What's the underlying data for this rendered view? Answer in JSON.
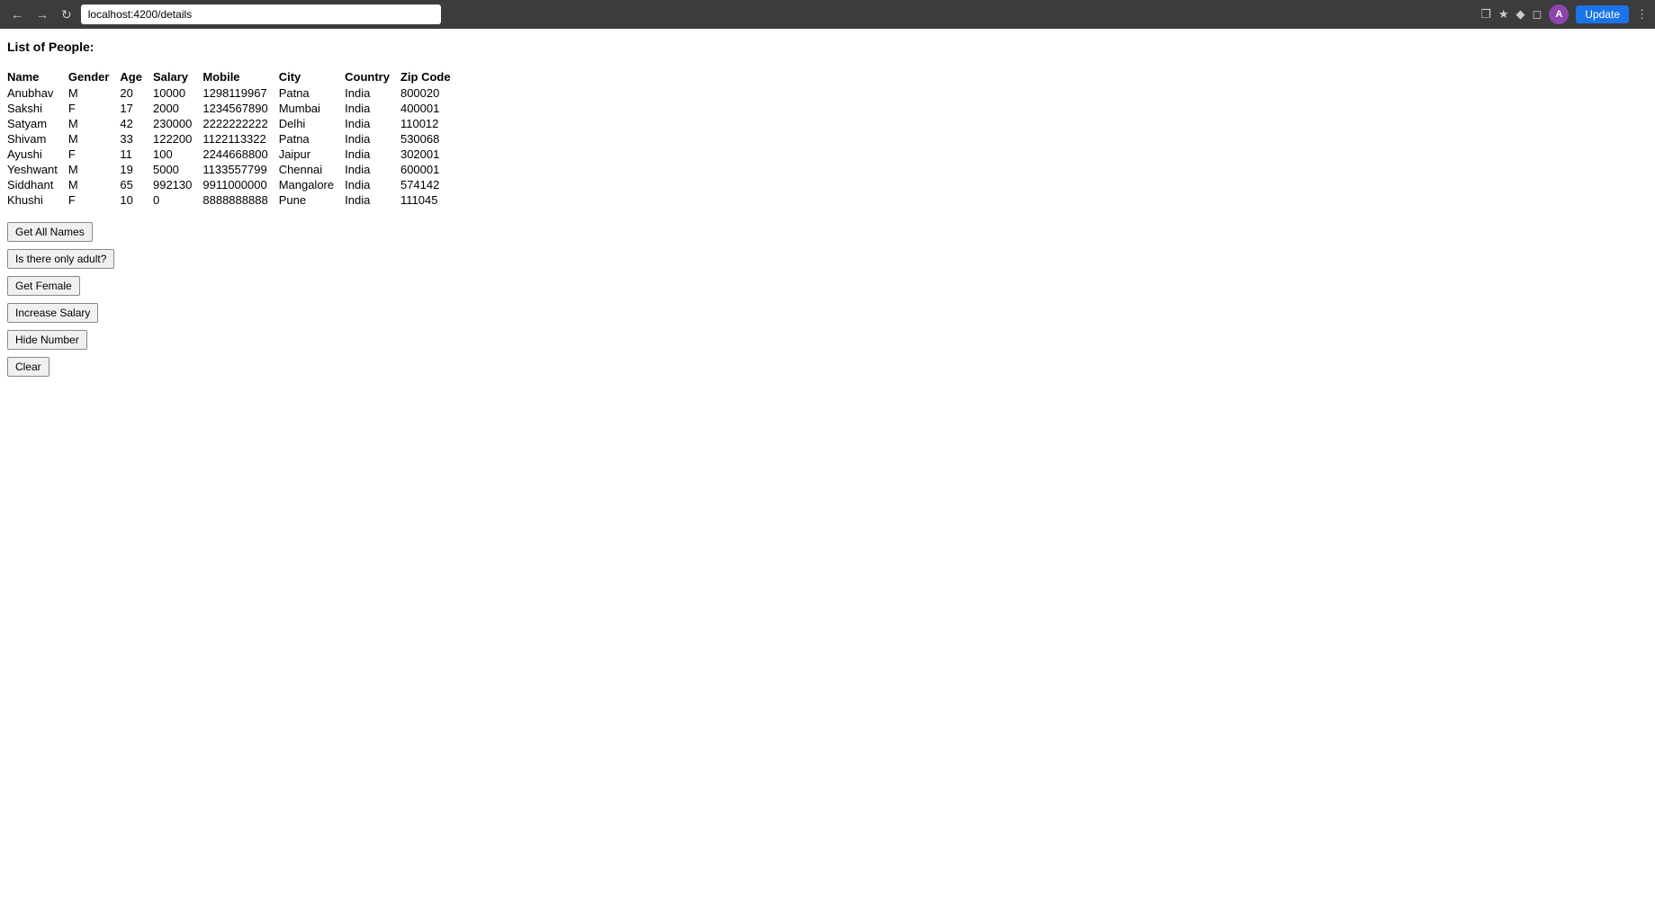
{
  "browser": {
    "url": "localhost:4200/details",
    "update_label": "Update",
    "avatar_letter": "A"
  },
  "page": {
    "title": "List of People:"
  },
  "table": {
    "headers": [
      "Name",
      "Gender",
      "Age",
      "Salary",
      "Mobile",
      "City",
      "Country",
      "Zip Code"
    ],
    "rows": [
      [
        "Anubhav",
        "M",
        "20",
        "10000",
        "1298119967",
        "Patna",
        "India",
        "800020"
      ],
      [
        "Sakshi",
        "F",
        "17",
        "2000",
        "1234567890",
        "Mumbai",
        "India",
        "400001"
      ],
      [
        "Satyam",
        "M",
        "42",
        "230000",
        "2222222222",
        "Delhi",
        "India",
        "110012"
      ],
      [
        "Shivam",
        "M",
        "33",
        "122200",
        "1122113322",
        "Patna",
        "India",
        "530068"
      ],
      [
        "Ayushi",
        "F",
        "11",
        "100",
        "2244668800",
        "Jaipur",
        "India",
        "302001"
      ],
      [
        "Yeshwant",
        "M",
        "19",
        "5000",
        "1133557799",
        "Chennai",
        "India",
        "600001"
      ],
      [
        "Siddhant",
        "M",
        "65",
        "992130",
        "9911000000",
        "Mangalore",
        "India",
        "574142"
      ],
      [
        "Khushi",
        "F",
        "10",
        "0",
        "8888888888",
        "Pune",
        "India",
        "111045"
      ]
    ]
  },
  "buttons": {
    "get_all_names": "Get All Names",
    "is_adult": "Is there only adult?",
    "get_female": "Get Female",
    "increase_salary": "Increase Salary",
    "hide_number": "Hide Number",
    "clear": "Clear"
  }
}
